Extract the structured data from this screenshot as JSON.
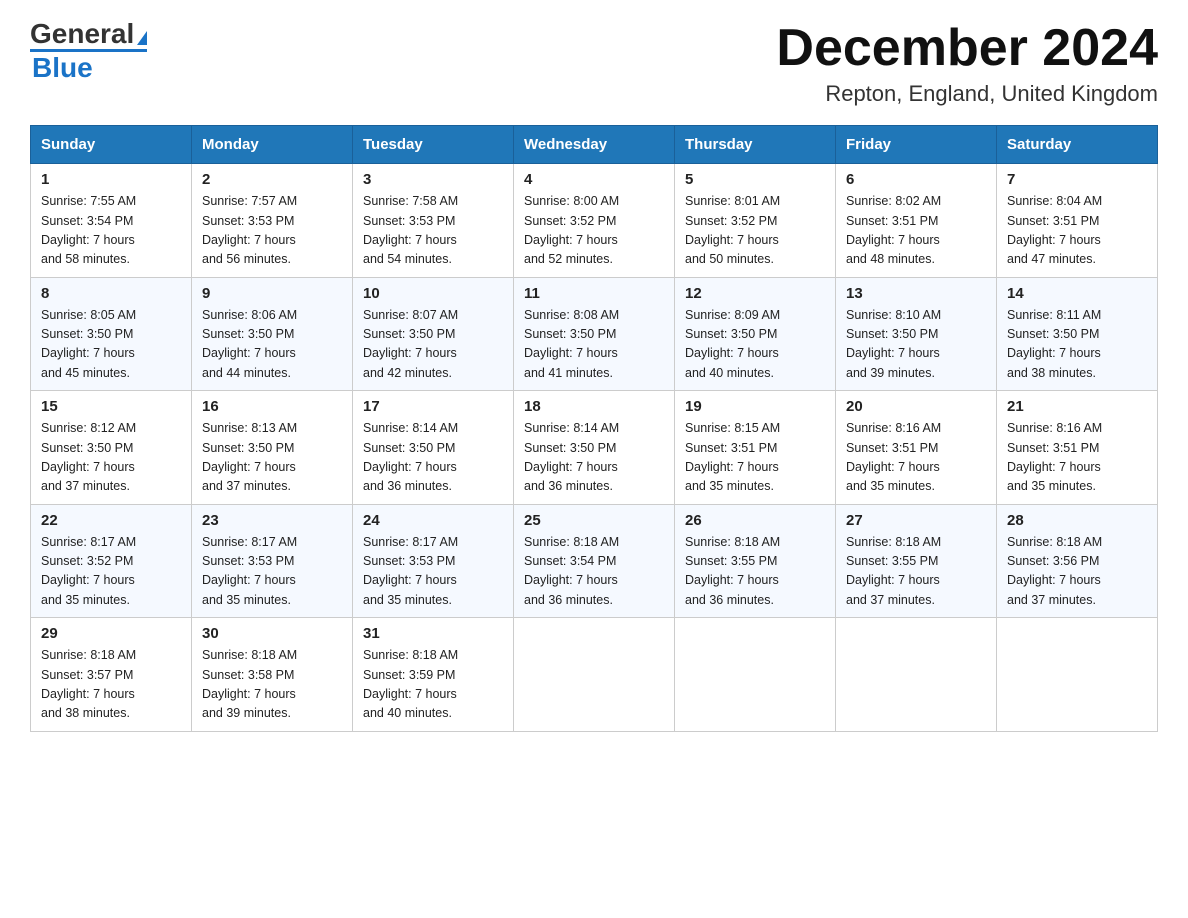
{
  "header": {
    "logo_general": "General",
    "logo_blue": "Blue",
    "title": "December 2024",
    "subtitle": "Repton, England, United Kingdom"
  },
  "columns": [
    "Sunday",
    "Monday",
    "Tuesday",
    "Wednesday",
    "Thursday",
    "Friday",
    "Saturday"
  ],
  "weeks": [
    [
      {
        "day": "1",
        "sunrise": "7:55 AM",
        "sunset": "3:54 PM",
        "daylight": "7 hours and 58 minutes."
      },
      {
        "day": "2",
        "sunrise": "7:57 AM",
        "sunset": "3:53 PM",
        "daylight": "7 hours and 56 minutes."
      },
      {
        "day": "3",
        "sunrise": "7:58 AM",
        "sunset": "3:53 PM",
        "daylight": "7 hours and 54 minutes."
      },
      {
        "day": "4",
        "sunrise": "8:00 AM",
        "sunset": "3:52 PM",
        "daylight": "7 hours and 52 minutes."
      },
      {
        "day": "5",
        "sunrise": "8:01 AM",
        "sunset": "3:52 PM",
        "daylight": "7 hours and 50 minutes."
      },
      {
        "day": "6",
        "sunrise": "8:02 AM",
        "sunset": "3:51 PM",
        "daylight": "7 hours and 48 minutes."
      },
      {
        "day": "7",
        "sunrise": "8:04 AM",
        "sunset": "3:51 PM",
        "daylight": "7 hours and 47 minutes."
      }
    ],
    [
      {
        "day": "8",
        "sunrise": "8:05 AM",
        "sunset": "3:50 PM",
        "daylight": "7 hours and 45 minutes."
      },
      {
        "day": "9",
        "sunrise": "8:06 AM",
        "sunset": "3:50 PM",
        "daylight": "7 hours and 44 minutes."
      },
      {
        "day": "10",
        "sunrise": "8:07 AM",
        "sunset": "3:50 PM",
        "daylight": "7 hours and 42 minutes."
      },
      {
        "day": "11",
        "sunrise": "8:08 AM",
        "sunset": "3:50 PM",
        "daylight": "7 hours and 41 minutes."
      },
      {
        "day": "12",
        "sunrise": "8:09 AM",
        "sunset": "3:50 PM",
        "daylight": "7 hours and 40 minutes."
      },
      {
        "day": "13",
        "sunrise": "8:10 AM",
        "sunset": "3:50 PM",
        "daylight": "7 hours and 39 minutes."
      },
      {
        "day": "14",
        "sunrise": "8:11 AM",
        "sunset": "3:50 PM",
        "daylight": "7 hours and 38 minutes."
      }
    ],
    [
      {
        "day": "15",
        "sunrise": "8:12 AM",
        "sunset": "3:50 PM",
        "daylight": "7 hours and 37 minutes."
      },
      {
        "day": "16",
        "sunrise": "8:13 AM",
        "sunset": "3:50 PM",
        "daylight": "7 hours and 37 minutes."
      },
      {
        "day": "17",
        "sunrise": "8:14 AM",
        "sunset": "3:50 PM",
        "daylight": "7 hours and 36 minutes."
      },
      {
        "day": "18",
        "sunrise": "8:14 AM",
        "sunset": "3:50 PM",
        "daylight": "7 hours and 36 minutes."
      },
      {
        "day": "19",
        "sunrise": "8:15 AM",
        "sunset": "3:51 PM",
        "daylight": "7 hours and 35 minutes."
      },
      {
        "day": "20",
        "sunrise": "8:16 AM",
        "sunset": "3:51 PM",
        "daylight": "7 hours and 35 minutes."
      },
      {
        "day": "21",
        "sunrise": "8:16 AM",
        "sunset": "3:51 PM",
        "daylight": "7 hours and 35 minutes."
      }
    ],
    [
      {
        "day": "22",
        "sunrise": "8:17 AM",
        "sunset": "3:52 PM",
        "daylight": "7 hours and 35 minutes."
      },
      {
        "day": "23",
        "sunrise": "8:17 AM",
        "sunset": "3:53 PM",
        "daylight": "7 hours and 35 minutes."
      },
      {
        "day": "24",
        "sunrise": "8:17 AM",
        "sunset": "3:53 PM",
        "daylight": "7 hours and 35 minutes."
      },
      {
        "day": "25",
        "sunrise": "8:18 AM",
        "sunset": "3:54 PM",
        "daylight": "7 hours and 36 minutes."
      },
      {
        "day": "26",
        "sunrise": "8:18 AM",
        "sunset": "3:55 PM",
        "daylight": "7 hours and 36 minutes."
      },
      {
        "day": "27",
        "sunrise": "8:18 AM",
        "sunset": "3:55 PM",
        "daylight": "7 hours and 37 minutes."
      },
      {
        "day": "28",
        "sunrise": "8:18 AM",
        "sunset": "3:56 PM",
        "daylight": "7 hours and 37 minutes."
      }
    ],
    [
      {
        "day": "29",
        "sunrise": "8:18 AM",
        "sunset": "3:57 PM",
        "daylight": "7 hours and 38 minutes."
      },
      {
        "day": "30",
        "sunrise": "8:18 AM",
        "sunset": "3:58 PM",
        "daylight": "7 hours and 39 minutes."
      },
      {
        "day": "31",
        "sunrise": "8:18 AM",
        "sunset": "3:59 PM",
        "daylight": "7 hours and 40 minutes."
      },
      null,
      null,
      null,
      null
    ]
  ],
  "labels": {
    "sunrise": "Sunrise:",
    "sunset": "Sunset:",
    "daylight": "Daylight:"
  }
}
